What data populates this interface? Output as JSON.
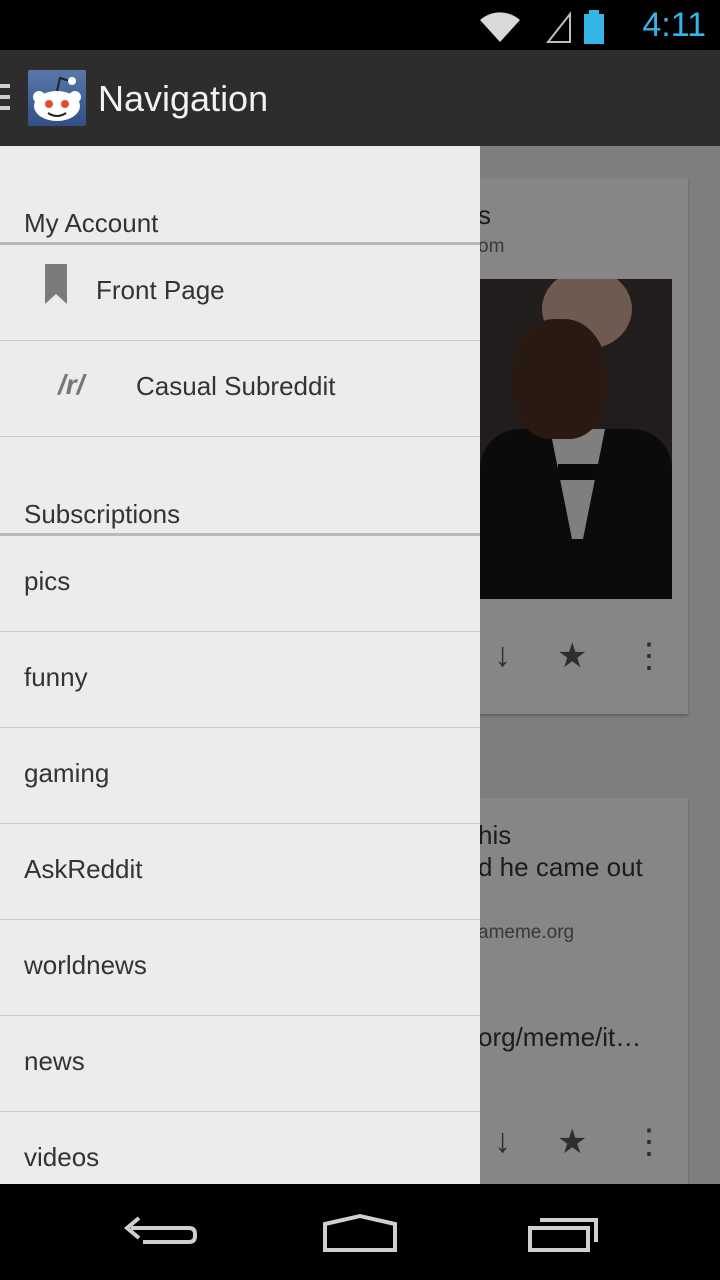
{
  "status_bar": {
    "time": "4:11",
    "icons": [
      "wifi-icon",
      "signal-icon",
      "battery-icon"
    ],
    "accent": "#33b5e5"
  },
  "action_bar": {
    "title": "Navigation",
    "logo_icon": "reddit-alien-icon",
    "menu_icon": "hamburger-icon"
  },
  "drawer": {
    "account_header": "My Account",
    "account_items": [
      {
        "label": "Front Page",
        "icon": "bookmark-icon"
      },
      {
        "label": "Casual Subreddit",
        "icon": "r-icon",
        "icon_text": "/r/"
      }
    ],
    "subscriptions_header": "Subscriptions",
    "subscriptions": [
      "pics",
      "funny",
      "gaming",
      "AskReddit",
      "worldnews",
      "news",
      "videos"
    ]
  },
  "background_content": {
    "card1_title_fragment": "s",
    "card1_domain_fragment": "om",
    "card2_title_line1": "his",
    "card2_title_line2": "d he came out",
    "card2_domain_fragment": "ameme.org",
    "card2_link_fragment": "org/meme/it…"
  },
  "nav_bar": {
    "buttons": [
      "back-icon",
      "home-icon",
      "recents-icon"
    ]
  }
}
